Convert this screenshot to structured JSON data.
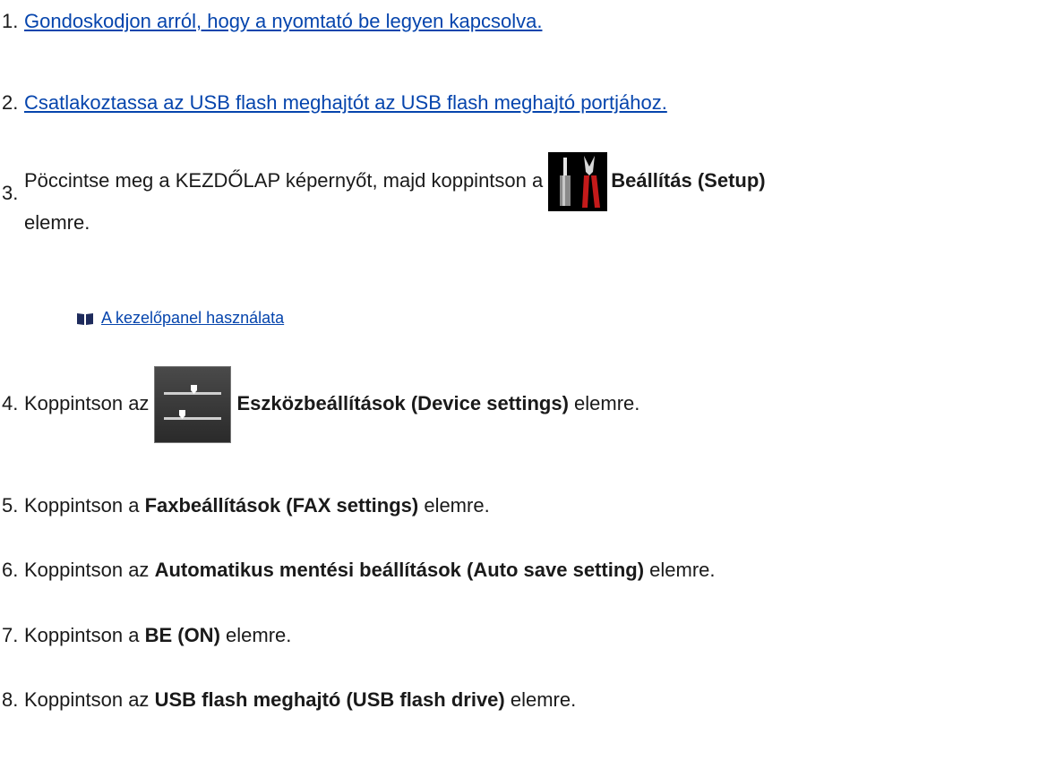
{
  "steps": [
    {
      "num": "1.",
      "link": "Gondoskodjon arról, hogy a nyomtató be legyen kapcsolva."
    },
    {
      "num": "2.",
      "link": "Csatlakoztassa az USB flash meghajtót az USB flash meghajtó portjához."
    },
    {
      "num": "3.",
      "pre": "Pöccintse meg a KEZDŐLAP képernyőt, majd koppintson a",
      "icon": "tools-icon",
      "bold": "Beállítás (Setup)",
      "post": "elemre."
    },
    {
      "num": "4.",
      "pre": "Koppintson az",
      "icon": "device-settings-icon",
      "bold": "Eszközbeállítások (Device settings)",
      "post": "elemre."
    },
    {
      "num": "5.",
      "pre": "Koppintson a",
      "bold": "Faxbeállítások (FAX settings)",
      "post": "elemre."
    },
    {
      "num": "6.",
      "pre": "Koppintson az",
      "bold": "Automatikus mentési beállítások (Auto save setting)",
      "post": "elemre."
    },
    {
      "num": "7.",
      "pre": "Koppintson a",
      "bold": "BE (ON)",
      "post": "elemre."
    },
    {
      "num": "8.",
      "pre": "Koppintson az",
      "bold": "USB flash meghajtó (USB flash drive)",
      "post": "elemre."
    }
  ],
  "sublink": {
    "icon": "book-icon",
    "label": "A kezelőpanel használata"
  },
  "colors": {
    "link": "#0645ad",
    "text": "#1a1a1a",
    "background": "#ffffff"
  }
}
